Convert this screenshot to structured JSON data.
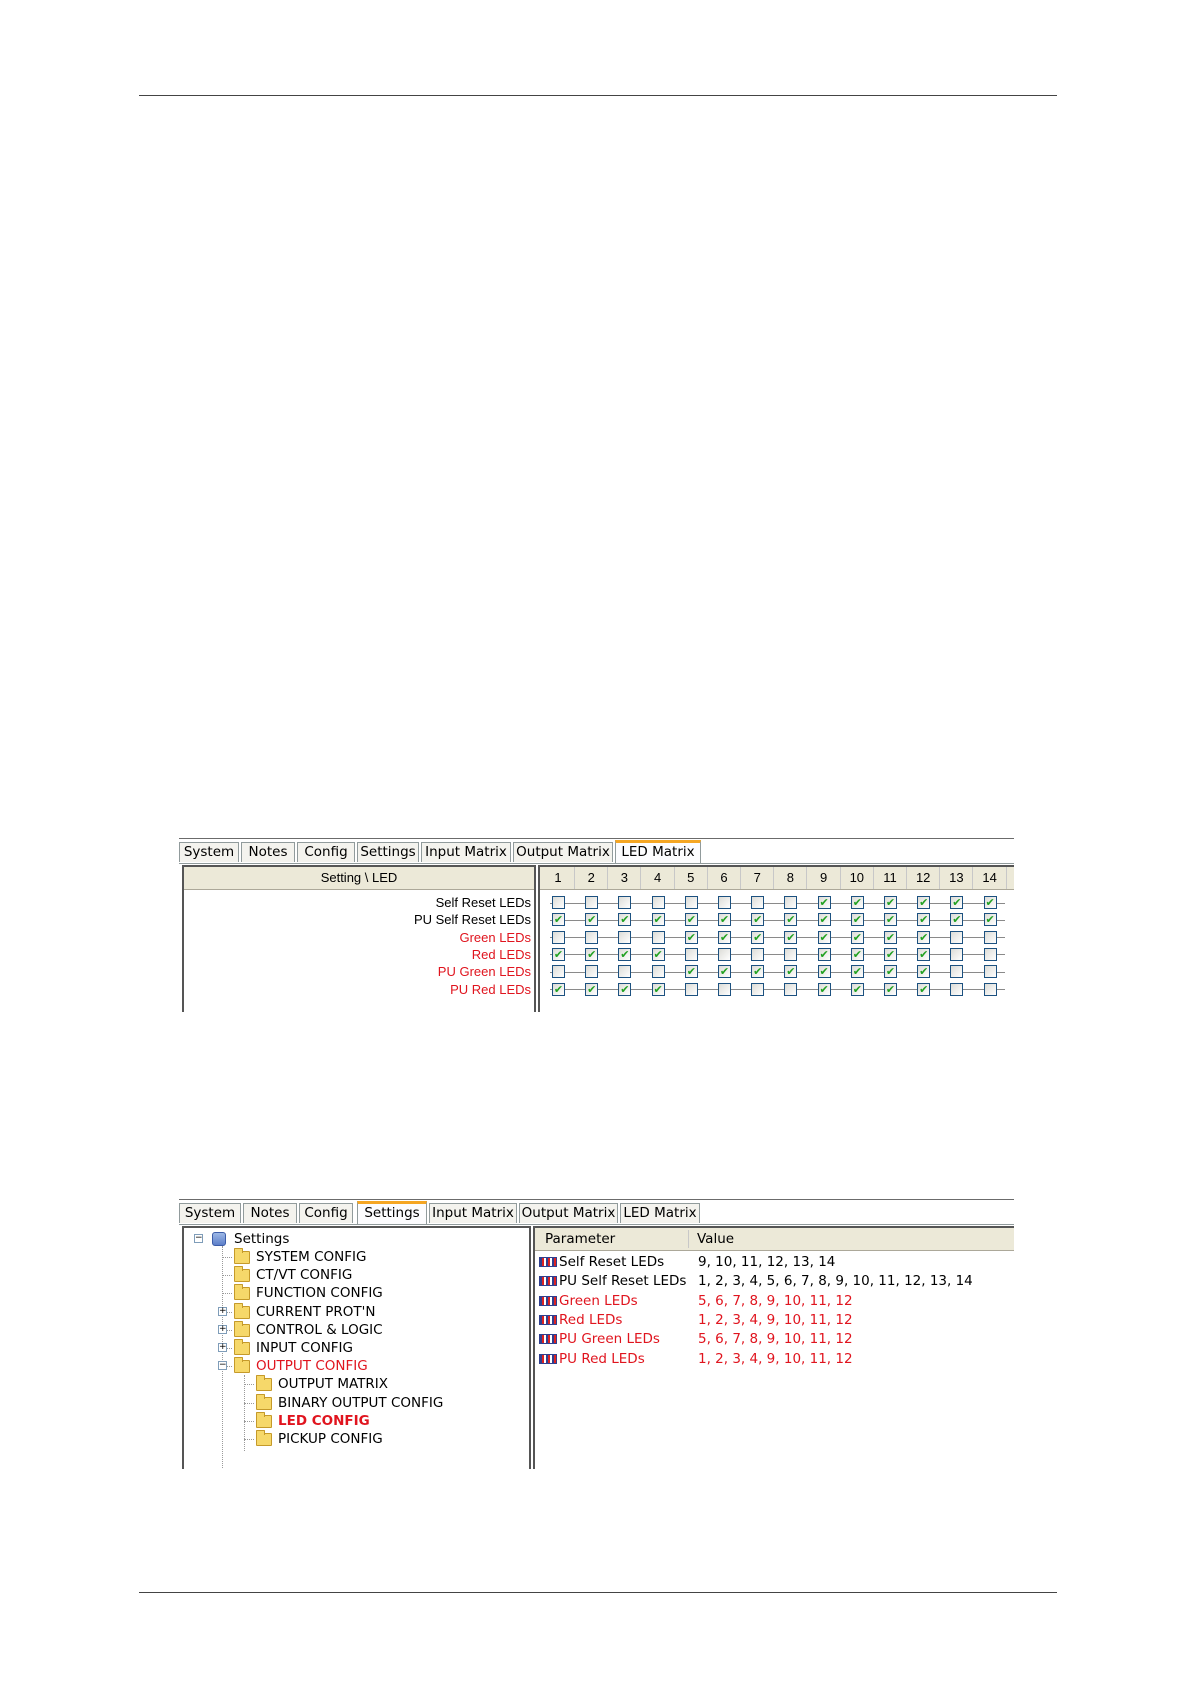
{
  "tabs_top": [
    "System",
    "Notes",
    "Config",
    "Settings",
    "Input Matrix",
    "Output Matrix",
    "LED Matrix"
  ],
  "tabs_bottom": [
    "System",
    "Notes",
    "Config",
    "Settings",
    "Input Matrix",
    "Output Matrix",
    "LED Matrix"
  ],
  "led_matrix": {
    "header": "Setting \\ LED",
    "columns": [
      "1",
      "2",
      "3",
      "4",
      "5",
      "6",
      "7",
      "8",
      "9",
      "10",
      "11",
      "12",
      "13",
      "14"
    ],
    "rows": [
      {
        "label": "Self Reset LEDs",
        "red": false,
        "checked": [
          0,
          0,
          0,
          0,
          0,
          0,
          0,
          0,
          1,
          1,
          1,
          1,
          1,
          1
        ]
      },
      {
        "label": "PU Self Reset LEDs",
        "red": false,
        "checked": [
          1,
          1,
          1,
          1,
          1,
          1,
          1,
          1,
          1,
          1,
          1,
          1,
          1,
          1
        ]
      },
      {
        "label": "Green LEDs",
        "red": true,
        "checked": [
          0,
          0,
          0,
          0,
          1,
          1,
          1,
          1,
          1,
          1,
          1,
          1,
          0,
          0
        ]
      },
      {
        "label": "Red LEDs",
        "red": true,
        "checked": [
          1,
          1,
          1,
          1,
          0,
          0,
          0,
          0,
          1,
          1,
          1,
          1,
          0,
          0
        ]
      },
      {
        "label": "PU Green LEDs",
        "red": true,
        "checked": [
          0,
          0,
          0,
          0,
          1,
          1,
          1,
          1,
          1,
          1,
          1,
          1,
          0,
          0
        ]
      },
      {
        "label": "PU Red LEDs",
        "red": true,
        "checked": [
          1,
          1,
          1,
          1,
          0,
          0,
          0,
          0,
          1,
          1,
          1,
          1,
          0,
          0
        ]
      }
    ]
  },
  "tree": {
    "root": "Settings",
    "items": [
      {
        "label": "SYSTEM CONFIG",
        "level": 1,
        "expander": "",
        "style": "normal"
      },
      {
        "label": "CT/VT CONFIG",
        "level": 1,
        "expander": "",
        "style": "normal"
      },
      {
        "label": "FUNCTION CONFIG",
        "level": 1,
        "expander": "",
        "style": "normal"
      },
      {
        "label": "CURRENT PROT'N",
        "level": 1,
        "expander": "+",
        "style": "normal"
      },
      {
        "label": "CONTROL & LOGIC",
        "level": 1,
        "expander": "+",
        "style": "normal"
      },
      {
        "label": "INPUT CONFIG",
        "level": 1,
        "expander": "+",
        "style": "normal"
      },
      {
        "label": "OUTPUT CONFIG",
        "level": 1,
        "expander": "−",
        "style": "red"
      },
      {
        "label": "OUTPUT MATRIX",
        "level": 2,
        "expander": "",
        "style": "normal"
      },
      {
        "label": "BINARY OUTPUT CONFIG",
        "level": 2,
        "expander": "",
        "style": "normal"
      },
      {
        "label": "LED CONFIG",
        "level": 2,
        "expander": "",
        "style": "bold-red"
      },
      {
        "label": "PICKUP CONFIG",
        "level": 2,
        "expander": "",
        "style": "normal"
      }
    ]
  },
  "param_list": {
    "col_parameter": "Parameter",
    "col_value": "Value",
    "rows": [
      {
        "param": "Self Reset LEDs",
        "value": "9, 10, 11, 12, 13, 14",
        "red": false
      },
      {
        "param": "PU Self Reset LEDs",
        "value": "1, 2, 3, 4, 5, 6, 7, 8, 9, 10, 11, 12, 13, 14",
        "red": false
      },
      {
        "param": "Green LEDs",
        "value": "5, 6, 7, 8, 9, 10, 11, 12",
        "red": true
      },
      {
        "param": "Red LEDs",
        "value": "1, 2, 3, 4, 9, 10, 11, 12",
        "red": true
      },
      {
        "param": "PU Green LEDs",
        "value": "5, 6, 7, 8, 9, 10, 11, 12",
        "red": true
      },
      {
        "param": "PU Red LEDs",
        "value": "1, 2, 3, 4, 9, 10, 11, 12",
        "red": true
      }
    ]
  }
}
